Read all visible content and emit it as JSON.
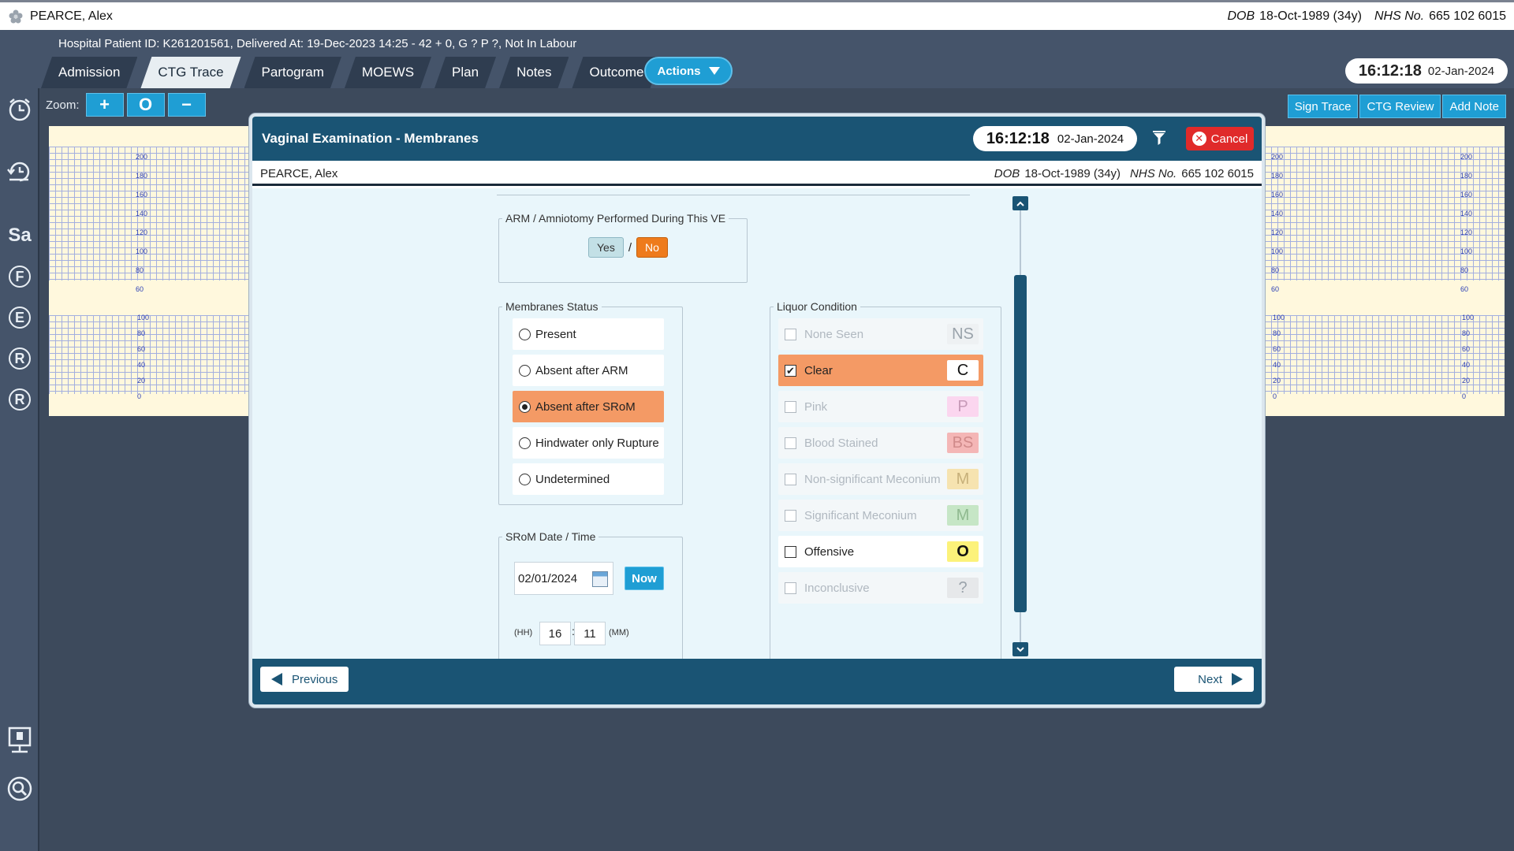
{
  "patient": {
    "name": "PEARCE, Alex",
    "dob_label": "DOB",
    "dob": "18-Oct-1989 (34y)",
    "nhs_label": "NHS No.",
    "nhs": "665 102 6015",
    "hospital_info": "Hospital Patient ID: K261201561, Delivered At: 19-Dec-2023 14:25 - 42 + 0, G ? P ?,   Not In Labour"
  },
  "tabs": [
    {
      "label": "Admission",
      "active": false
    },
    {
      "label": "CTG Trace",
      "active": true
    },
    {
      "label": "Partogram",
      "active": false
    },
    {
      "label": "MOEWS",
      "active": false
    },
    {
      "label": "Plan",
      "active": false
    },
    {
      "label": "Notes",
      "active": false
    },
    {
      "label": "Outcome",
      "active": false
    }
  ],
  "actions_label": "Actions",
  "clock": {
    "time": "16:12:18",
    "date": "02-Jan-2024"
  },
  "zoom": {
    "label": "Zoom:",
    "plus": "+",
    "reset": "O",
    "minus": "−"
  },
  "right_buttons": [
    "Sign Trace",
    "CTG Review",
    "Add Note"
  ],
  "sidebar_letters": [
    "Sa",
    "F",
    "E",
    "R",
    "R"
  ],
  "ctg": {
    "fhr_ticks": [
      "200",
      "180",
      "160",
      "140",
      "120",
      "100",
      "80",
      "60"
    ],
    "toco_ticks": [
      "100",
      "80",
      "60",
      "40",
      "20",
      "0"
    ]
  },
  "dialog": {
    "title": "Vaginal Examination - Membranes",
    "cancel": "Cancel",
    "previous": "Previous",
    "next": "Next",
    "arm": {
      "legend": "ARM / Amniotomy Performed During This VE",
      "yes": "Yes",
      "sep": "/",
      "no": "No",
      "selected": "No"
    },
    "membranes": {
      "legend": "Membranes Status",
      "options": [
        {
          "label": "Present",
          "selected": false
        },
        {
          "label": "Absent after ARM",
          "selected": false
        },
        {
          "label": "Absent after SRoM",
          "selected": true
        },
        {
          "label": "Hindwater only Rupture",
          "selected": false
        },
        {
          "label": "Undetermined",
          "selected": false
        }
      ]
    },
    "srom": {
      "legend": "SRoM Date / Time",
      "date": "02/01/2024",
      "now": "Now",
      "hh_label": "(HH)",
      "hh": "16",
      "sep": ":",
      "mm": "11",
      "mm_label": "(MM)"
    },
    "liquor": {
      "legend": "Liquor Condition",
      "options": [
        {
          "label": "None Seen",
          "code": "NS",
          "checked": false,
          "enabled": false,
          "badge_bg": "#eef1f3",
          "badge_fg": "#9aa3ab"
        },
        {
          "label": "Clear",
          "code": "C",
          "checked": true,
          "enabled": true,
          "badge_bg": "#ffffff",
          "badge_fg": "#111111"
        },
        {
          "label": "Pink",
          "code": "P",
          "checked": false,
          "enabled": false,
          "badge_bg": "#fbd6ef",
          "badge_fg": "#c79ab8"
        },
        {
          "label": "Blood Stained",
          "code": "BS",
          "checked": false,
          "enabled": false,
          "badge_bg": "#f4b6b6",
          "badge_fg": "#d08a8a"
        },
        {
          "label": "Non-significant Meconium",
          "code": "M",
          "checked": false,
          "enabled": false,
          "badge_bg": "#f6e3b0",
          "badge_fg": "#c7b07a"
        },
        {
          "label": "Significant Meconium",
          "code": "M",
          "checked": false,
          "enabled": false,
          "badge_bg": "#c6e6c6",
          "badge_fg": "#8fb98f"
        },
        {
          "label": "Offensive",
          "code": "O",
          "checked": false,
          "enabled": true,
          "badge_bg": "#fcf27a",
          "badge_fg": "#111111"
        },
        {
          "label": "Inconclusive",
          "code": "?",
          "checked": false,
          "enabled": false,
          "badge_bg": "#e6e8ea",
          "badge_fg": "#9aa3ab"
        }
      ]
    }
  }
}
